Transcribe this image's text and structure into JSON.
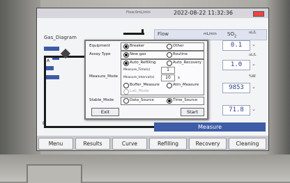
{
  "status": {
    "center": "Flow:0mL/min",
    "datetime": "2022-08-22 11:32:36"
  },
  "diagram": {
    "title": "Gas_Diagram",
    "port_a": "A",
    "port_b": "B"
  },
  "right": {
    "flow_label": "Flow",
    "flow_unit": "mL/min",
    "so2_label": "SO",
    "so2_sub": "2",
    "values": [
      "0.1",
      "1.0",
      "9853",
      "71.8"
    ],
    "units": [
      "uL/L",
      "uL/L",
      "%W",
      ""
    ],
    "measure": "Measure"
  },
  "dialog": {
    "equipment_label": "Equipment",
    "equipment_opts": [
      "Breaker",
      "Other"
    ],
    "equipment_selected": "Breaker",
    "assay_label": "Assay Type",
    "assay_opts": [
      "New gas",
      "Routine"
    ],
    "assay_selected": "New gas",
    "measure_mode_label": "Measure_Mode",
    "mode_opts": [
      "Auto_Refilling",
      "Auto_Recovery",
      "Buffer_Measure",
      "Atm_Measure",
      "Lab_Mode"
    ],
    "mode_selected": "Auto_Refilling",
    "measure_times_label": "Measure_Time(s)",
    "measure_times_value": "1",
    "measure_interval_label": "Measure_Interval(s)",
    "measure_interval_value": "10",
    "interval_unit": "s",
    "stable_label": "Stable_Mode",
    "stable_opts": [
      "Data_Source",
      "Time_Source"
    ],
    "stable_selected": "Time_Source",
    "exit": "Exit",
    "start": "Start"
  },
  "menu": [
    "Menu",
    "Results",
    "Curve",
    "Refilling",
    "Recovery",
    "Cleaning"
  ],
  "colors": {
    "accent": "#3e5ca8",
    "value_text": "#2d3e8c"
  }
}
